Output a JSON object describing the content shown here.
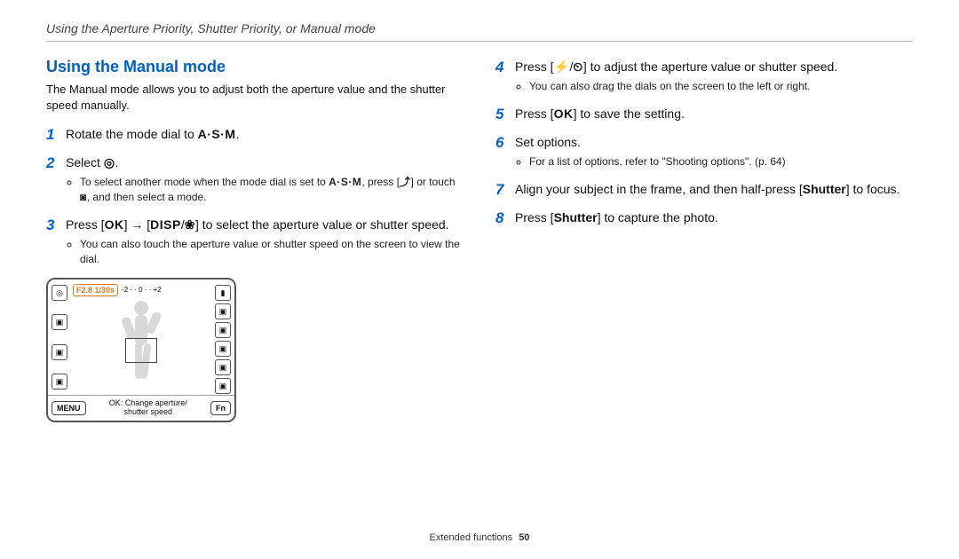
{
  "running_head": "Using the Aperture Priority, Shutter Priority, or Manual mode",
  "heading": "Using the Manual mode",
  "intro": "The Manual mode allows you to adjust both the aperture value and the shutter speed manually.",
  "glyphs": {
    "asm": "A·S·M",
    "mode_icon": "◎",
    "ok": "OK",
    "disp": "DISP",
    "macro": "❀",
    "flash": "⚡",
    "timer": "⏲",
    "return": "⤴",
    "cam": "◙"
  },
  "steps_left": {
    "1": {
      "pre": "Rotate the mode dial to ",
      "post": "."
    },
    "2": {
      "pre": "Select ",
      "post": ".",
      "sub_a": "To select another mode when the mode dial is set to ",
      "sub_b": ", press [",
      "sub_c": "] or touch ",
      "sub_d": ", and then select a mode."
    },
    "3": {
      "a": "Press [",
      "b": "] → [",
      "c": "/",
      "d": "] to select the aperture value or shutter speed.",
      "sub": "You can also touch the aperture value or shutter speed on the screen to view the dial."
    }
  },
  "steps_right": {
    "4": {
      "a": "Press [",
      "b": "/",
      "c": "] to adjust the aperture value or shutter speed.",
      "sub": "You can also drag the dials on the screen to the left or right."
    },
    "5": {
      "a": "Press [",
      "b": "] to save the setting."
    },
    "6": {
      "text": "Set options.",
      "sub": "For a list of options, refer to \"Shooting options\". (p. 64)"
    },
    "7": {
      "a": "Align your subject in the frame, and then half-press [",
      "b": "Shutter",
      "c": "] to focus."
    },
    "8": {
      "a": "Press [",
      "b": "Shutter",
      "c": "] to capture the photo."
    }
  },
  "lcd": {
    "exposure": "F2.8 1/30s",
    "ev_ticks": "-2 · · 0 · · +2",
    "menu": "MENU",
    "fn": "Fn",
    "msg_line1": "OK: Change aperture/",
    "msg_line2": "shutter speed"
  },
  "footer": {
    "section": "Extended functions",
    "page": "50"
  }
}
